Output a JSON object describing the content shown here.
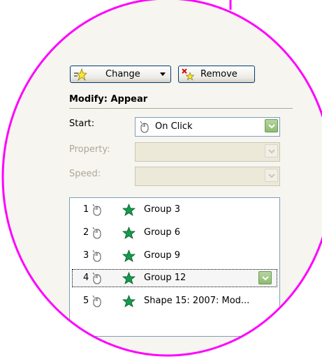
{
  "colors": {
    "highlight_ring": "#ff00ff",
    "panel_bg": "#f6f5ef",
    "dropdown_green": "#8dbc70",
    "disabled_text": "#aca899"
  },
  "toolbar": {
    "change_label": "Change",
    "change_icon": "star-effect-icon",
    "remove_label": "Remove",
    "remove_icon": "remove-effect-icon"
  },
  "modify": {
    "title": "Modify: Appear",
    "start": {
      "label": "Start:",
      "value": "On Click",
      "icon": "mouse-icon"
    },
    "property": {
      "label": "Property:",
      "value": ""
    },
    "speed": {
      "label": "Speed:",
      "value": ""
    }
  },
  "animation_list": [
    {
      "index": "1",
      "name": "Group 3",
      "selected": false
    },
    {
      "index": "2",
      "name": "Group 6",
      "selected": false
    },
    {
      "index": "3",
      "name": "Group 9",
      "selected": false
    },
    {
      "index": "4",
      "name": "Group 12",
      "selected": true
    },
    {
      "index": "5",
      "name": "Shape 15: 2007: Mod...",
      "selected": false
    }
  ]
}
